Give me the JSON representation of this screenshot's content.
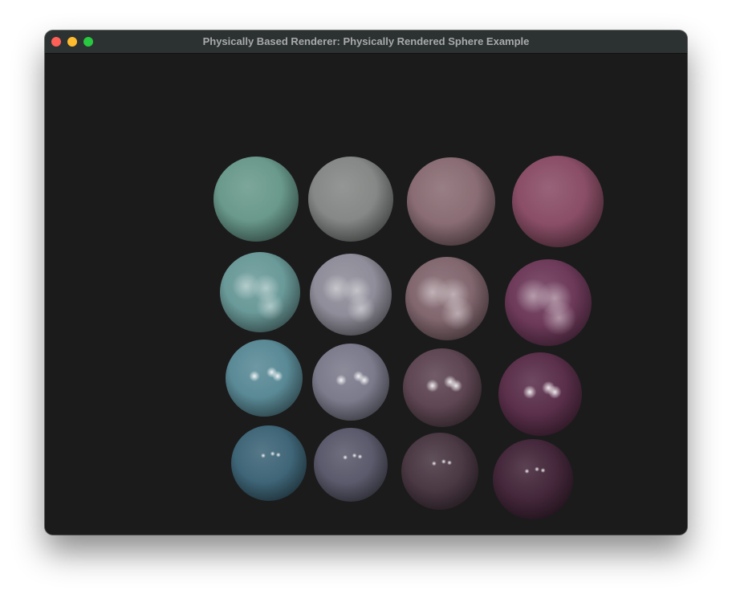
{
  "window": {
    "title": "Physically Based Renderer: Physically Rendered Sphere Example",
    "controls": [
      "close",
      "minimize",
      "zoom"
    ],
    "background": "#1b1b1b"
  },
  "spheres": {
    "rows": 4,
    "columns": 4,
    "colors": [
      [
        "#6a9a8c",
        "#858886",
        "#8a6d74",
        "#8a4e66"
      ],
      [
        "#6a9a99",
        "#8f8d99",
        "#82676f",
        "#6e3a5a"
      ],
      [
        "#5a8a96",
        "#7c7b8c",
        "#5e4652",
        "#5a2f4a"
      ],
      [
        "#3f6678",
        "#5b5a6c",
        "#4a3843",
        "#44273a"
      ]
    ]
  }
}
